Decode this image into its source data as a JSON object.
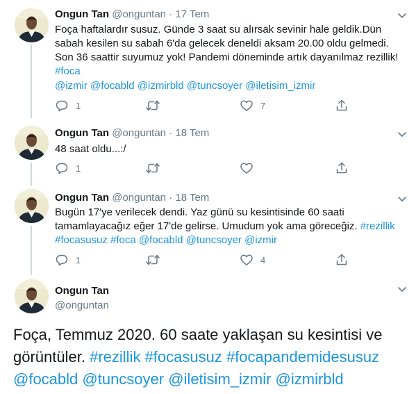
{
  "tweets": [
    {
      "name": "Ongun Tan",
      "handle": "@onguntan",
      "separator": "·",
      "date": "17 Tem",
      "text": "Foça haftalardır susuz. Günde 3 saat su alırsak sevinir hale geldik.Dün sabah kesilen su sabah 6'da gelecek deneldi aksam 20.00 oldu gelmedi. Son 36 saattir suyumuz yok! Pandemi döneminde artık dayanılmaz rezillik!",
      "text_link": "#foca",
      "mentions": "@izmir @focabld  @izmirbld @tuncsoyer @iletisim_izmir",
      "replies": "1",
      "retweets": "",
      "likes": "7"
    },
    {
      "name": "Ongun Tan",
      "handle": "@onguntan",
      "separator": "·",
      "date": "18 Tem",
      "text": "48 saat oldu...:/",
      "replies": "1",
      "retweets": "",
      "likes": ""
    },
    {
      "name": "Ongun Tan",
      "handle": "@onguntan",
      "separator": "·",
      "date": "18 Tem",
      "text": "Bugün 17'ye verilecek dendi. Yaz günü su kesintisinde 60 saati tamamlayacağız eğer 17'de gelirse. Umudum yok ama göreceğiz.",
      "text_link": "#rezillik",
      "links_line": "#focasusuz #foca @focabld @tuncsoyer @izmir",
      "replies": "1",
      "retweets": "",
      "likes": "4"
    }
  ],
  "main_tweet": {
    "name": "Ongun Tan",
    "handle": "@onguntan",
    "text": "Foça, Temmuz 2020. 60 saate yaklaşan su kesintisi ve görüntüler.",
    "links": "#rezillik #focasusuz #focapandemidesusuz @focabld @tuncsoyer @iletisim_izmir @izmirbld"
  },
  "colors": {
    "link": "#1b95e0",
    "secondary_text": "#657786",
    "divider": "#e6ecf0",
    "thread_line": "#ccd6dd"
  },
  "icons": [
    "chevron-down-icon",
    "reply-icon",
    "retweet-icon",
    "like-icon",
    "share-icon"
  ]
}
